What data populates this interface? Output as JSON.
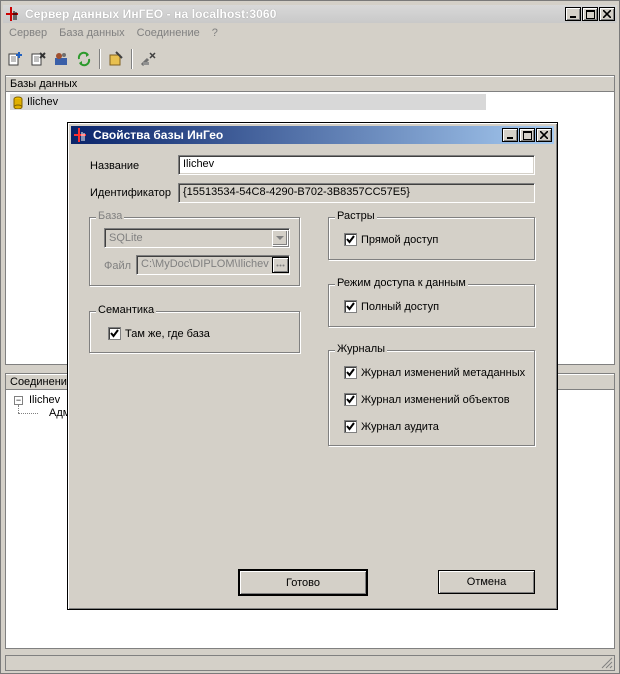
{
  "main_window": {
    "title": "Сервер данных ИнГЕО - на localhost:3060"
  },
  "menu": [
    {
      "label": "Сервер"
    },
    {
      "label": "База данных"
    },
    {
      "label": "Соединение"
    },
    {
      "label": "?"
    }
  ],
  "toolbar": {
    "icons": [
      "add-db-icon",
      "delete-db-icon",
      "settings-icon",
      "refresh-icon",
      "properties-icon",
      "disconnect-icon"
    ]
  },
  "databases_panel": {
    "header": "Базы данных",
    "items": [
      {
        "label": "Ilichev"
      }
    ]
  },
  "connections_panel": {
    "header": "Соединения",
    "tree_root": "Ilichev",
    "tree_child": "Адм"
  },
  "dialog": {
    "title": "Свойства базы ИнГео",
    "name_label": "Название",
    "name_value": "Ilichev",
    "id_label": "Идентификатор",
    "id_value": "{15513534-54C8-4290-B702-3B8357CC57E5}",
    "base_group": {
      "legend": "База",
      "type_value": "SQLite",
      "file_label": "Файл",
      "file_value": "C:\\MyDoc\\DIPLOM\\Ilichev"
    },
    "semantics_group": {
      "legend": "Семантика",
      "checkbox_label": "Там же, где база",
      "checked": true
    },
    "rasters_group": {
      "legend": "Растры",
      "checkbox_label": "Прямой доступ",
      "checked": true
    },
    "access_group": {
      "legend": "Режим доступа к данным",
      "checkbox_label": "Полный доступ",
      "checked": true
    },
    "journals_group": {
      "legend": "Журналы",
      "items": [
        {
          "label": "Журнал изменений метаданных",
          "checked": true
        },
        {
          "label": "Журнал изменений объектов",
          "checked": true
        },
        {
          "label": "Журнал аудита",
          "checked": true
        }
      ]
    },
    "ok_label": "Готово",
    "cancel_label": "Отмена"
  }
}
